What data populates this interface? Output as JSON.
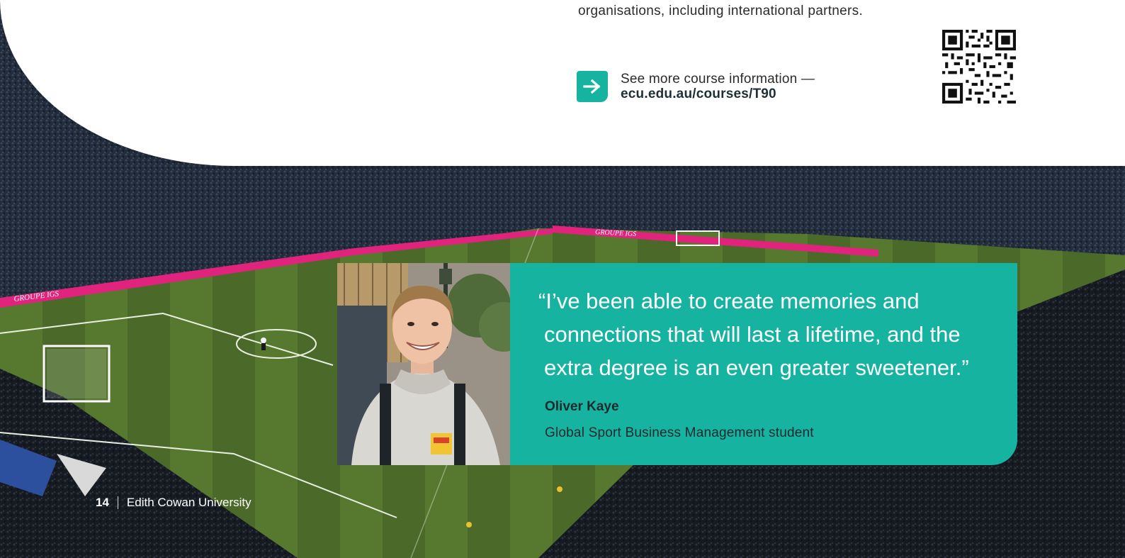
{
  "intro": {
    "partial_line": "organisations, including international partners."
  },
  "course_link": {
    "prefix": "See more course information —",
    "url": "ecu.edu.au/courses/T90",
    "icon": "arrow-right-icon"
  },
  "testimonial": {
    "quote": "“I’ve been able to create memories and connections that will last a lifetime, and the extra degree is an even greater sweetener.”",
    "name": "Oliver Kaye",
    "role": "Global Sport Business Management student"
  },
  "ad_board_text": "GROUPE IGS",
  "footer": {
    "page_number": "14",
    "publisher": "Edith Cowan University"
  },
  "colors": {
    "accent_teal": "#16b3a1",
    "pitch_green": "#4d6b2c",
    "ad_board_pink": "#e0237c",
    "crowd_dark": "#1c2633"
  }
}
